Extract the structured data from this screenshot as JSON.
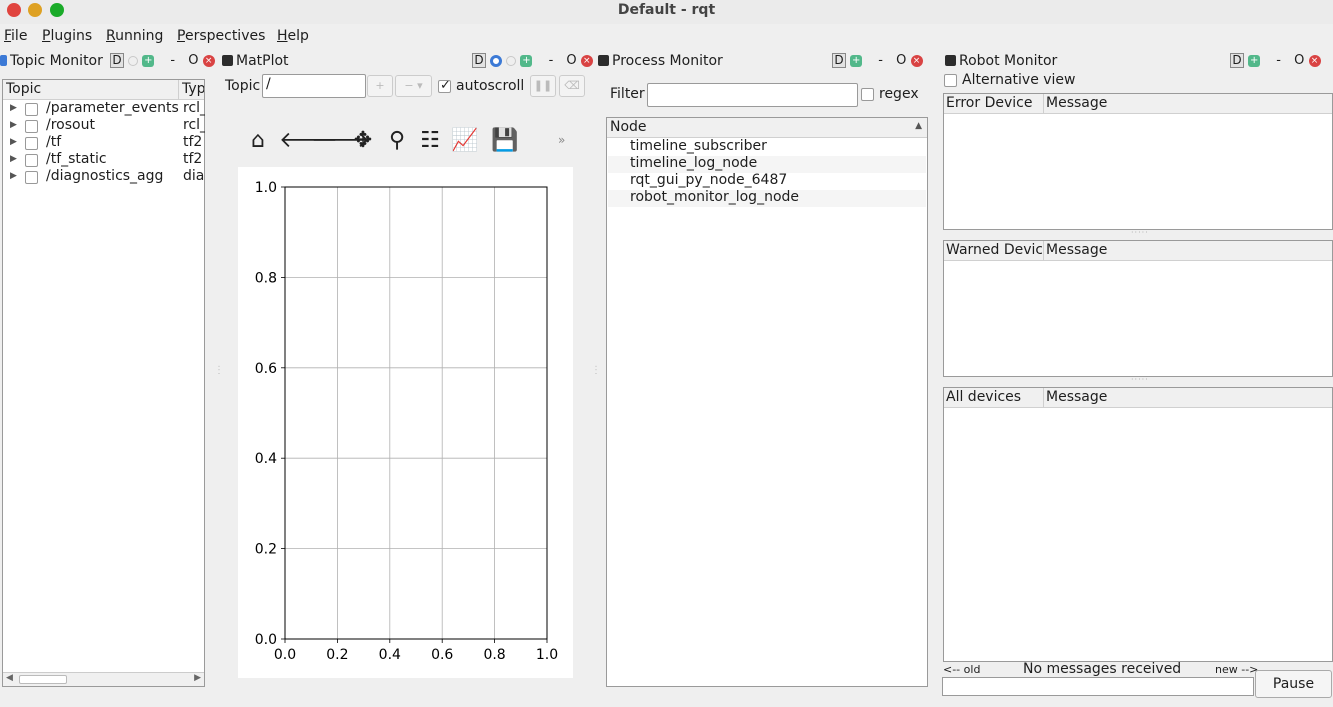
{
  "window": {
    "title": "Default - rqt",
    "traffic_lights": {
      "close": "#e0443e",
      "minimize": "#dea123",
      "maximize": "#1aab29"
    }
  },
  "menu": {
    "items": [
      {
        "label": "File",
        "u": "F",
        "rest": "ile"
      },
      {
        "label": "Plugins",
        "u": "P",
        "rest": "lugins"
      },
      {
        "label": "Running",
        "u": "R",
        "rest": "unning"
      },
      {
        "label": "Perspectives",
        "u": "P",
        "rest": "erspectives"
      },
      {
        "label": "Help",
        "u": "H",
        "rest": "elp"
      }
    ]
  },
  "panel_controls": {
    "d": "D",
    "minus": "-",
    "o": "O",
    "close": "×",
    "plus": "+"
  },
  "topic_monitor": {
    "title": "Topic Monitor",
    "columns": [
      "Topic",
      "Typ"
    ],
    "rows": [
      {
        "topic": "/parameter_events",
        "type": "rcl_"
      },
      {
        "topic": "/rosout",
        "type": "rcl_"
      },
      {
        "topic": "/tf",
        "type": "tf2"
      },
      {
        "topic": "/tf_static",
        "type": "tf2"
      },
      {
        "topic": "/diagnostics_agg",
        "type": "dia"
      }
    ]
  },
  "matplot": {
    "title": "MatPlot",
    "topic_label": "Topic",
    "topic_value": "/",
    "add_button": "+",
    "remove_button": "−",
    "autoscroll_label": "autoscroll",
    "autoscroll_checked": true,
    "toolbar": [
      {
        "name": "home-icon",
        "glyph": "⌂"
      },
      {
        "name": "back-icon",
        "glyph": "🡐"
      },
      {
        "name": "forward-icon",
        "glyph": "🡒"
      },
      {
        "name": "pan-icon",
        "glyph": "✥"
      },
      {
        "name": "zoom-icon",
        "glyph": "⚲"
      },
      {
        "name": "configure-subplots-icon",
        "glyph": "☷"
      },
      {
        "name": "edit-axis-icon",
        "glyph": "📈"
      },
      {
        "name": "save-icon",
        "glyph": "💾"
      }
    ],
    "overflow": "»"
  },
  "chart_data": {
    "type": "line",
    "series": [],
    "xlim": [
      0.0,
      1.0
    ],
    "ylim": [
      0.0,
      1.0
    ],
    "xticks": [
      "0.0",
      "0.2",
      "0.4",
      "0.6",
      "0.8",
      "1.0"
    ],
    "yticks": [
      "0.0",
      "0.2",
      "0.4",
      "0.6",
      "0.8",
      "1.0"
    ],
    "grid": true
  },
  "process_monitor": {
    "title": "Process Monitor",
    "filter_label": "Filter",
    "filter_value": "",
    "regex_label": "regex",
    "column": "Node",
    "nodes": [
      "timeline_subscriber",
      "timeline_log_node",
      "rqt_gui_py_node_6487",
      "robot_monitor_log_node"
    ]
  },
  "robot_monitor": {
    "title": "Robot Monitor",
    "alt_view_label": "Alternative view",
    "tables": [
      {
        "col1": "Error Device",
        "col2": "Message"
      },
      {
        "col1": "Warned Device",
        "col2": "Message"
      },
      {
        "col1": "All devices",
        "col2": "Message"
      }
    ],
    "old_label": "<-- old",
    "status": "No messages received",
    "new_label": "new -->",
    "pause_button": "Pause"
  }
}
